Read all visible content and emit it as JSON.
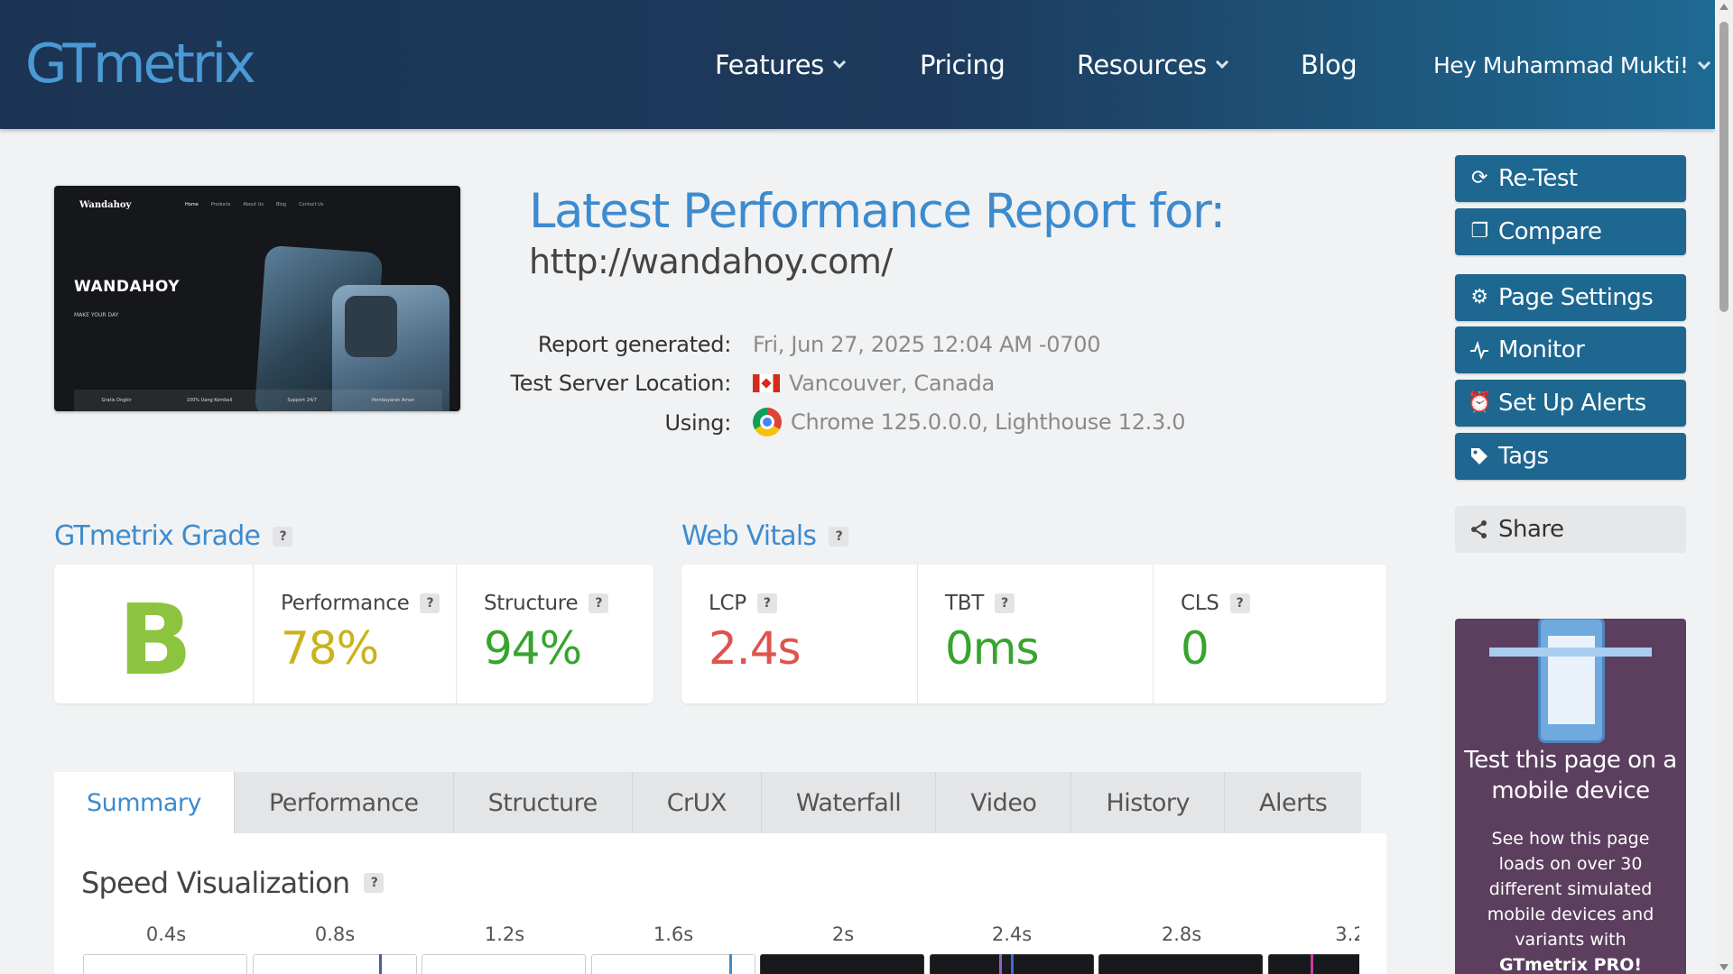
{
  "header": {
    "logo": "GTmetrix",
    "nav": [
      {
        "label": "Features",
        "dropdown": true
      },
      {
        "label": "Pricing",
        "dropdown": false
      },
      {
        "label": "Resources",
        "dropdown": true
      },
      {
        "label": "Blog",
        "dropdown": false
      }
    ],
    "user": "Hey Muhammad Mukti!"
  },
  "thumbnail": {
    "brand": "Wandahoy",
    "nav": [
      "Home",
      "Products",
      "About Us",
      "Blog",
      "Contact Us"
    ],
    "headline": "WANDAHOY",
    "tagline": "MAKE YOUR DAY",
    "features": [
      "Gratis Ongkir",
      "100% Uang Kembali",
      "Support 24/7",
      "Pembayaran Aman"
    ]
  },
  "report": {
    "title": "Latest Performance Report for:",
    "url": "http://wandahoy.com/",
    "generated_label": "Report generated:",
    "generated_value": "Fri, Jun 27, 2025 12:04 AM -0700",
    "location_label": "Test Server Location:",
    "location_value": "Vancouver, Canada",
    "using_label": "Using:",
    "using_value": "Chrome 125.0.0.0, Lighthouse 12.3.0"
  },
  "sidebar": {
    "buttons": [
      "Re-Test",
      "Compare",
      "Page Settings",
      "Monitor",
      "Set Up Alerts",
      "Tags"
    ],
    "share": "Share",
    "promo_title": "Test this page on a mobile device",
    "promo_text": "See how this page loads on over 30 different simulated mobile devices and variants with",
    "promo_bold": "GTmetrix PRO!"
  },
  "grade": {
    "section_title": "GTmetrix Grade",
    "letter": "B",
    "performance_label": "Performance",
    "performance_value": "78%",
    "structure_label": "Structure",
    "structure_value": "94%"
  },
  "vitals": {
    "section_title": "Web Vitals",
    "lcp_label": "LCP",
    "lcp_value": "2.4s",
    "tbt_label": "TBT",
    "tbt_value": "0ms",
    "cls_label": "CLS",
    "cls_value": "0"
  },
  "colors": {
    "brand_blue": "#3d8bcf",
    "button": "#1d6790",
    "performance": "#c9b31c",
    "good": "#37a42d",
    "poor": "#e0534d",
    "promo_bg": "#5c3f5e"
  },
  "tabs": [
    "Summary",
    "Performance",
    "Structure",
    "CrUX",
    "Waterfall",
    "Video",
    "History",
    "Alerts"
  ],
  "active_tab": "Summary",
  "speed": {
    "title": "Speed Visualization",
    "ticks": [
      "0.4s",
      "0.8s",
      "1.2s",
      "1.6s",
      "2s",
      "2.4s",
      "2.8s",
      "3.2"
    ]
  }
}
